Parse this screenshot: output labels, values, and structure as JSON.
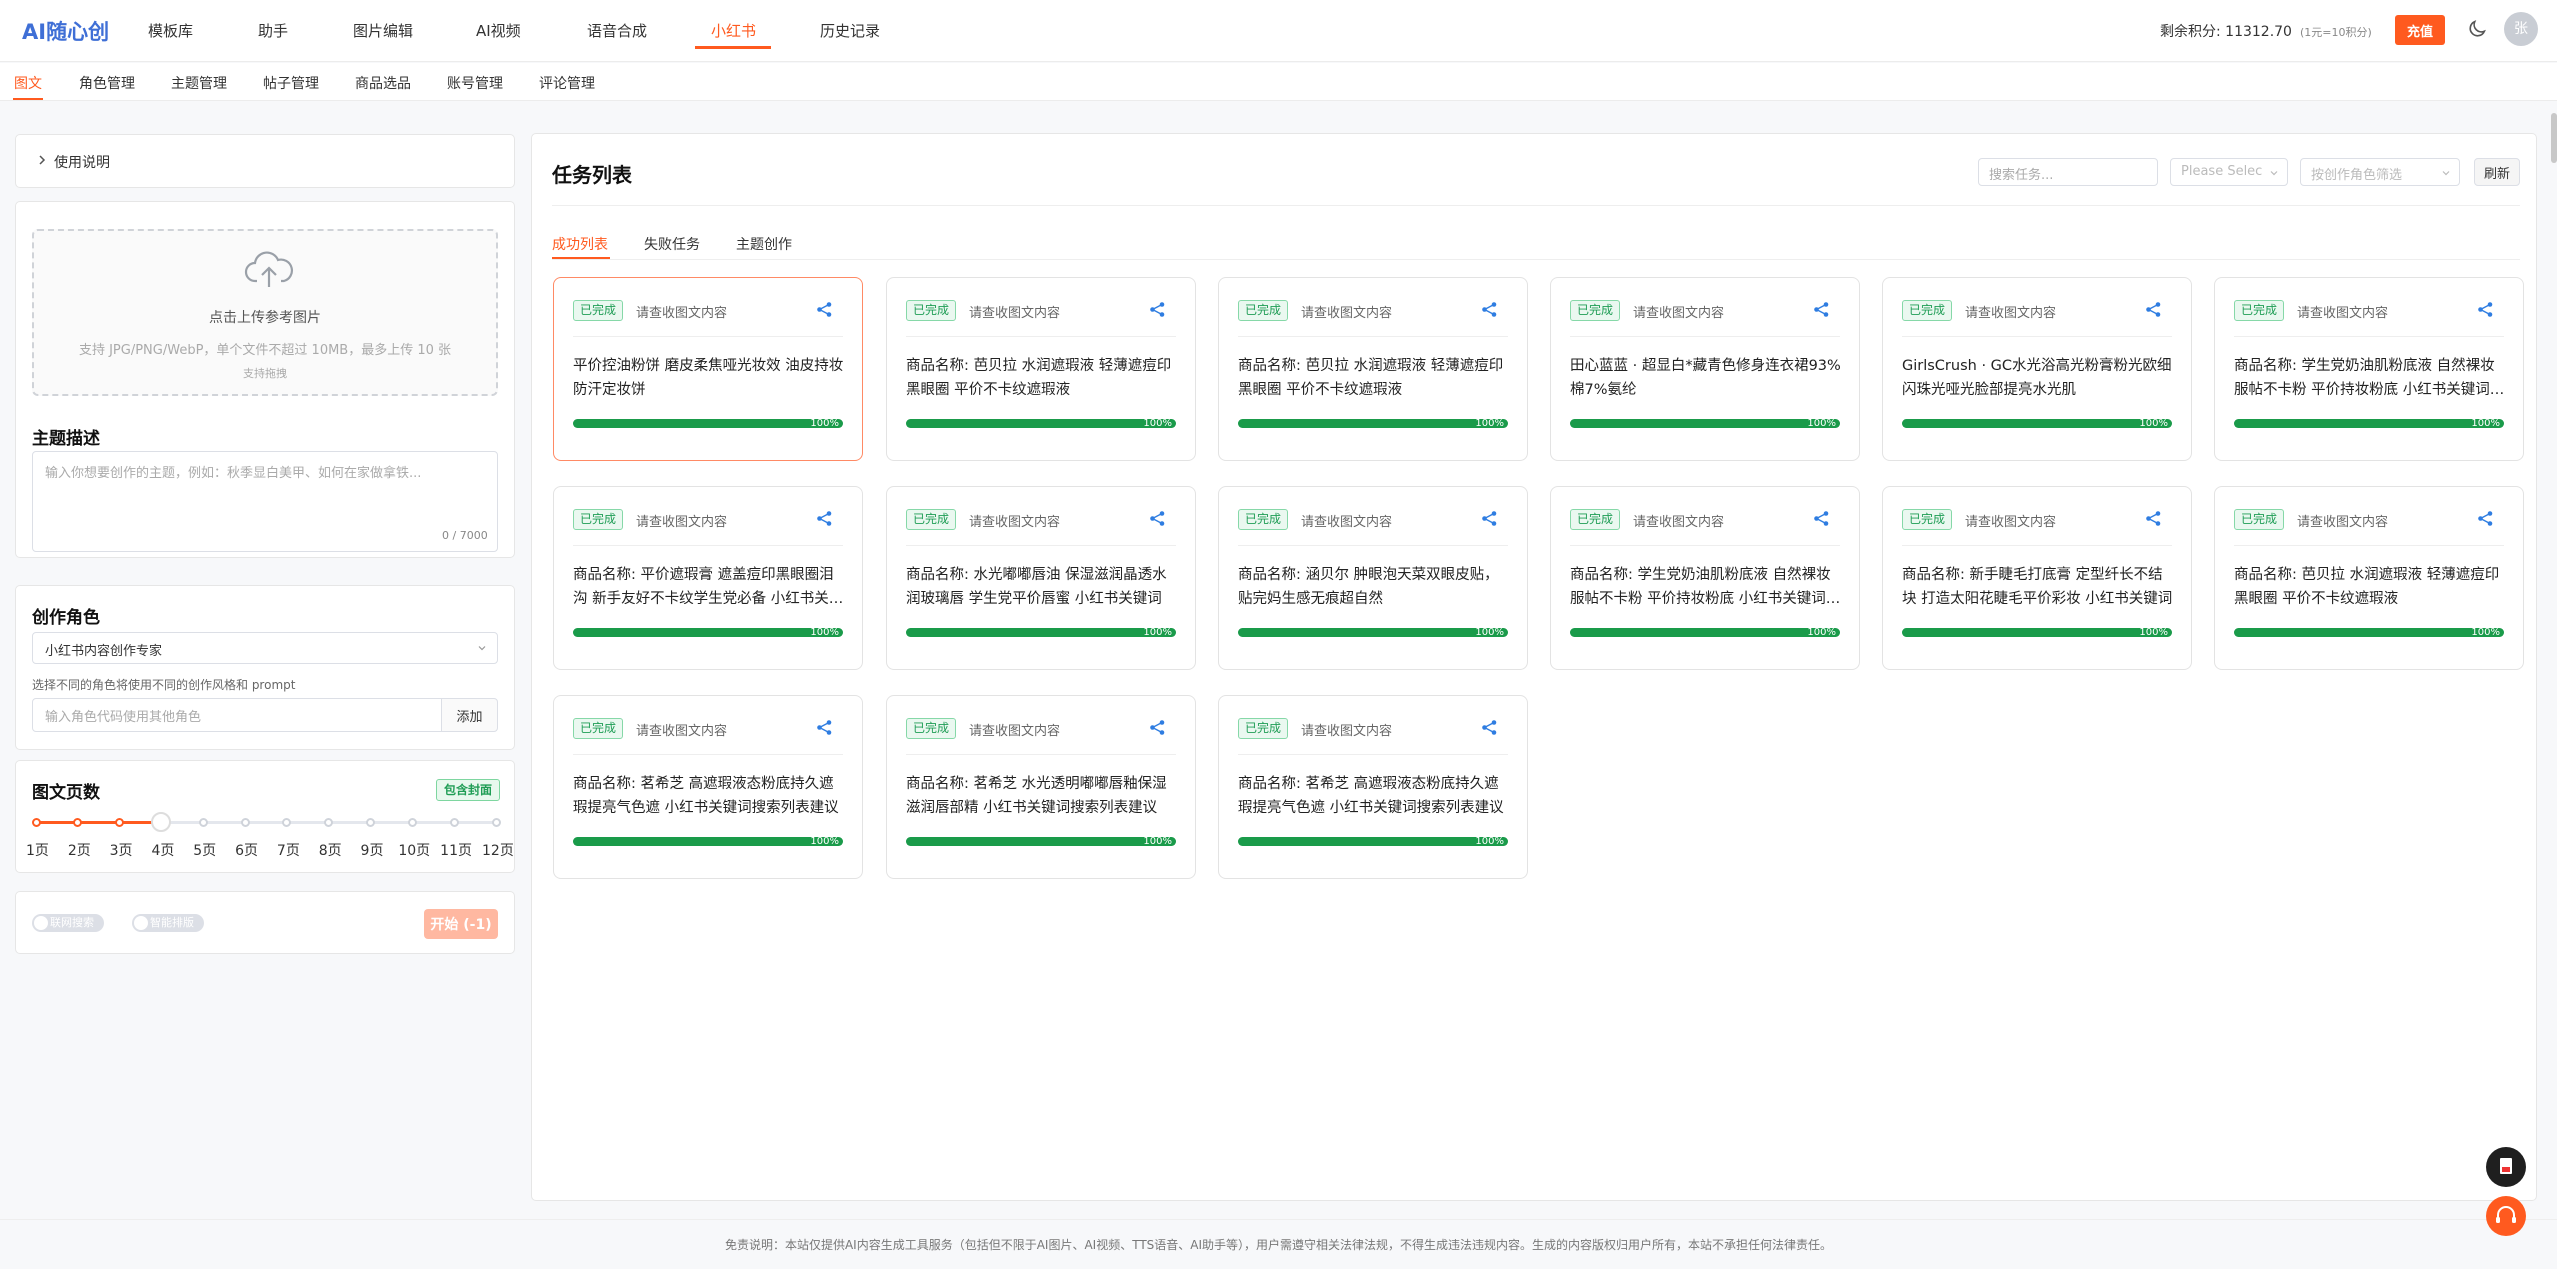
{
  "app": {
    "logo": "AI随心创"
  },
  "nav": {
    "items": [
      "模板库",
      "助手",
      "图片编辑",
      "AI视频",
      "语音合成",
      "小红书",
      "历史记录"
    ],
    "credits": "剩余积分: 11312.70",
    "credits_note": "(1元=10积分)",
    "recharge": "充值",
    "avatar": "张"
  },
  "subnav": {
    "items": [
      "图文",
      "角色管理",
      "主题管理",
      "帖子管理",
      "商品选品",
      "账号管理",
      "评论管理"
    ]
  },
  "usage": {
    "label": "使用说明"
  },
  "upload": {
    "title": "点击上传参考图片",
    "hint": "支持 JPG/PNG/WebP，单个文件不超过 10MB，最多上传 10 张",
    "drag": "支持拖拽"
  },
  "topic": {
    "title": "主题描述",
    "placeholder": "输入你想要创作的主题，例如：秋季显白美甲、如何在家做拿铁...",
    "count": "0 / 7000"
  },
  "role": {
    "title": "创作角色",
    "selected": "小红书内容创作专家",
    "note": "选择不同的角色将使用不同的创作风格和 prompt",
    "input_placeholder": "输入角色代码使用其他角色",
    "add": "添加"
  },
  "pages": {
    "title": "图文页数",
    "cover_badge": "包含封面",
    "selected": 4,
    "ticks": [
      "1页",
      "2页",
      "3页",
      "4页",
      "5页",
      "6页",
      "7页",
      "8页",
      "9页",
      "10页",
      "11页",
      "12页"
    ]
  },
  "actions": {
    "toggle1": "联网搜索",
    "toggle2": "智能排版",
    "start": "开始 (-1)"
  },
  "tasks": {
    "title": "任务列表",
    "search_placeholder": "搜索任务...",
    "filter1_placeholder": "Please Selec",
    "filter2_placeholder": "按创作角色筛选",
    "refresh": "刷新",
    "tabs": [
      "成功列表",
      "失败任务",
      "主题创作"
    ],
    "status_label": "已完成",
    "card_hint": "请查收图文内容",
    "cards": [
      {
        "title": "平价控油粉饼 磨皮柔焦哑光妆效 油皮持妆防汗定妆饼",
        "progress": 100,
        "progress_text": "100%"
      },
      {
        "title": "商品名称: 芭贝拉 水润遮瑕液 轻薄遮痘印黑眼圈 平价不卡纹遮瑕液",
        "progress": 100,
        "progress_text": "100%"
      },
      {
        "title": "商品名称: 芭贝拉 水润遮瑕液 轻薄遮痘印黑眼圈 平价不卡纹遮瑕液",
        "progress": 100,
        "progress_text": "100%"
      },
      {
        "title": "田心蓝蓝 · 超显白*藏青色修身连衣裙93%棉7%氨纶",
        "progress": 100,
        "progress_text": "100%"
      },
      {
        "title": "GirlsCrush · GC水光浴高光粉膏粉光欧细闪珠光哑光脸部提亮水光肌",
        "progress": 100,
        "progress_text": "100%"
      },
      {
        "title": "商品名称: 学生党奶油肌粉底液 自然裸妆服帖不卡粉 平价持妆粉底 小红书关键词搜索",
        "progress": 100,
        "progress_text": "100%"
      },
      {
        "title": "商品名称: 平价遮瑕膏 遮盖痘印黑眼圈泪沟 新手友好不卡纹学生党必备 小红书关键词",
        "progress": 100,
        "progress_text": "100%"
      },
      {
        "title": "商品名称: 水光嘟嘟唇油 保湿滋润晶透水润玻璃唇 学生党平价唇蜜 小红书关键词",
        "progress": 100,
        "progress_text": "100%"
      },
      {
        "title": "商品名称: 涵贝尔 肿眼泡天菜双眼皮贴，贴完妈生感无痕超自然",
        "progress": 100,
        "progress_text": "100%"
      },
      {
        "title": "商品名称: 学生党奶油肌粉底液 自然裸妆服帖不卡粉 平价持妆粉底 小红书关键词搜索",
        "progress": 100,
        "progress_text": "100%"
      },
      {
        "title": "商品名称: 新手睫毛打底膏 定型纤长不结块 打造太阳花睫毛平价彩妆 小红书关键词",
        "progress": 100,
        "progress_text": "100%"
      },
      {
        "title": "商品名称: 芭贝拉 水润遮瑕液 轻薄遮痘印黑眼圈 平价不卡纹遮瑕液",
        "progress": 100,
        "progress_text": "100%"
      },
      {
        "title": "商品名称: 茗希芝 高遮瑕液态粉底持久遮瑕提亮气色遮 小红书关键词搜索列表建议",
        "progress": 100,
        "progress_text": "100%"
      },
      {
        "title": "商品名称: 茗希芝 水光透明嘟嘟唇釉保湿滋润唇部精 小红书关键词搜索列表建议",
        "progress": 100,
        "progress_text": "100%"
      },
      {
        "title": "商品名称: 茗希芝 高遮瑕液态粉底持久遮瑕提亮气色遮 小红书关键词搜索列表建议",
        "progress": 100,
        "progress_text": "100%"
      }
    ]
  },
  "footer": {
    "text": "免责说明：本站仅提供AI内容生成工具服务（包括但不限于AI图片、AI视频、TTS语音、AI助手等），用户需遵守相关法律法规，不得生成违法违规内容。生成的内容版权归用户所有，本站不承担任何法律责任。"
  },
  "colors": {
    "accent": "#ff5a1f",
    "success": "#1a9b4a",
    "link": "#3f6fd6"
  }
}
